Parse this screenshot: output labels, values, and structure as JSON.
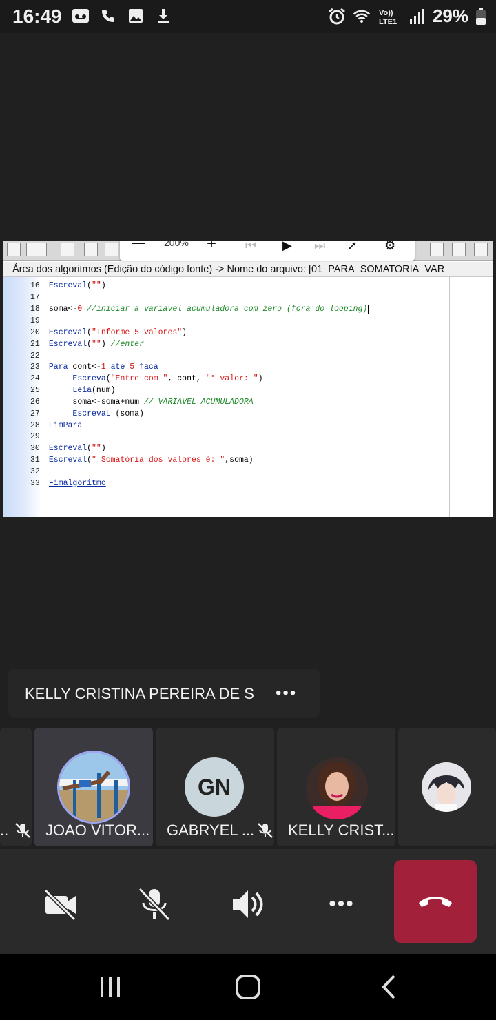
{
  "status_bar": {
    "time": "16:49",
    "battery": "29%",
    "icons_left": [
      "voicemail-icon",
      "phone-icon",
      "image-icon",
      "download-icon"
    ],
    "icons_right": [
      "alarm-icon",
      "wifi-icon",
      "volte-icon",
      "signal-icon",
      "battery-icon"
    ]
  },
  "shared_screen": {
    "zoom_label": "200%",
    "window_title": "Área dos algoritmos (Edição do código fonte) -> Nome do arquivo: [01_PARA_SOMATORIA_VAR",
    "code": {
      "l16": {
        "n": "16",
        "a": "Escreval",
        "b": "(",
        "c": "\"\"",
        "d": ")"
      },
      "l17": {
        "n": "17"
      },
      "l18": {
        "n": "18",
        "a": "soma<-",
        "b": "0",
        "c": " //iniciar a variavel acumuladora com zero (fora do looping)"
      },
      "l19": {
        "n": "19"
      },
      "l20": {
        "n": "20",
        "a": "Escreval",
        "b": "(",
        "c": "\"Informe 5 valores\"",
        "d": ")"
      },
      "l21": {
        "n": "21",
        "a": "Escreval",
        "b": "(",
        "c": "\"\"",
        "d": ") ",
        "e": "//enter"
      },
      "l22": {
        "n": "22"
      },
      "l23": {
        "n": "23",
        "a": "Para",
        "b": " cont<-",
        "c": "1",
        "d": " ate ",
        "e": "5",
        "f": " faca"
      },
      "l24": {
        "n": "24",
        "a": "     Escreva",
        "b": "(",
        "c": "\"Entre com \"",
        "d": ", cont, ",
        "e": "\"° valor: \"",
        "f": ")"
      },
      "l25": {
        "n": "25",
        "a": "     Leia",
        "b": "(num)"
      },
      "l26": {
        "n": "26",
        "a": "     soma<-soma+num ",
        "b": "// VARIAVEL ACUMULADORA"
      },
      "l27": {
        "n": "27",
        "a": "     EscrevaL",
        "b": " (soma)"
      },
      "l28": {
        "n": "28",
        "a": "FimPara"
      },
      "l29": {
        "n": "29"
      },
      "l30": {
        "n": "30",
        "a": "Escreval",
        "b": "(",
        "c": "\"\"",
        "d": ")"
      },
      "l31": {
        "n": "31",
        "a": "Escreval",
        "b": "(",
        "c": "\" Somatória dos valores é: \"",
        "d": ",soma)"
      },
      "l32": {
        "n": "32"
      },
      "l33": {
        "n": "33",
        "a": "Fimalgoritmo"
      }
    }
  },
  "presenter_bar": {
    "name": "KELLY CRISTINA PEREIRA DE S",
    "more": "•••"
  },
  "participants": [
    {
      "name": "..",
      "muted": true
    },
    {
      "name": "JOAO VITOR...",
      "muted": false,
      "active": true
    },
    {
      "name": "GABRYEL ...",
      "initials": "GN",
      "muted": true
    },
    {
      "name": "KELLY CRIST...",
      "muted": false
    },
    {
      "name": "",
      "muted": false
    }
  ],
  "controls": {
    "more": "•••"
  },
  "colors": {
    "hangup": "#a3203a",
    "background": "#202020",
    "code_keyword": "#0b2da3",
    "code_string": "#d61a1a",
    "code_comment": "#1f8a2a"
  }
}
